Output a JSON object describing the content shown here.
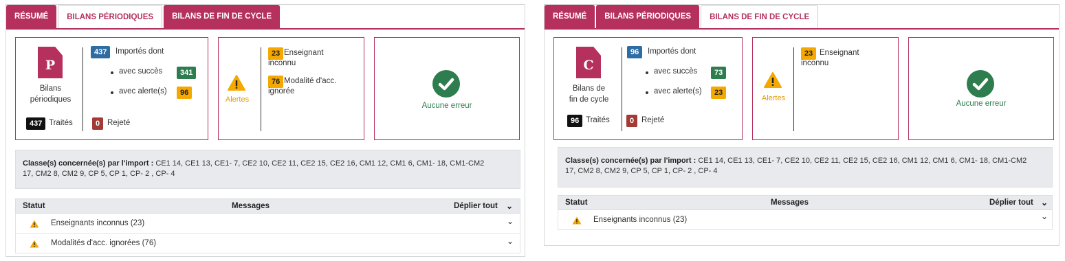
{
  "tabs": {
    "resume": "RÉSUMÉ",
    "periodiques": "BILANS PÉRIODIQUES",
    "fin_cycle": "BILANS DE FIN DE CYCLE"
  },
  "colors": {
    "primary": "#b5305c",
    "success": "#2e7d4f",
    "warning": "#f5a800",
    "info": "#2e6da4",
    "danger": "#a23b36"
  },
  "left": {
    "active_tab": "BILANS PÉRIODIQUES",
    "doc_letter": "P",
    "doc_label_1": "Bilans",
    "doc_label_2": "périodiques",
    "imported_count": "437",
    "imported_label": "Importés dont",
    "success_label": "avec succès",
    "success_count": "341",
    "alert_label": "avec alerte(s)",
    "alert_count": "96",
    "treated_count": "437",
    "treated_label": "Traités",
    "rejected_count": "0",
    "rejected_label": "Rejeté",
    "alerts_title": "Alertes",
    "alert1_count": "23",
    "alert1_line1": "Enseignant",
    "alert1_line2": "inconnu",
    "alert2_count": "76",
    "alert2_line1": "Modalité d'acc.",
    "alert2_line2": "ignorée",
    "no_error": "Aucune erreur",
    "classes_label": "Classe(s) concernée(s) par l'import :",
    "classes_line1": " CE1 14, CE1 13, CE1- 7, CE2 10, CE2 11, CE2 15, CE2 16, CM1 12, CM1 6, CM1- 18, CM1-CM2",
    "classes_line2": "17, CM2 8, CM2 9, CP 5, CP 1, CP- 2 , CP- 4",
    "col_status": "Statut",
    "col_messages": "Messages",
    "expand_all": "Déplier tout",
    "rows": [
      "Enseignants inconnus (23)",
      "Modalités d'acc. ignorées (76)"
    ]
  },
  "right": {
    "active_tab": "BILANS DE FIN DE CYCLE",
    "doc_letter": "C",
    "doc_label_1": "Bilans de",
    "doc_label_2": "fin de cycle",
    "imported_count": "96",
    "imported_label": "Importés dont",
    "success_label": "avec succès",
    "success_count": "73",
    "alert_label": "avec alerte(s)",
    "alert_count": "23",
    "treated_count": "96",
    "treated_label": "Traités",
    "rejected_count": "0",
    "rejected_label": "Rejeté",
    "alerts_title": "Alertes",
    "alert1_count": "23",
    "alert1_line1": "Enseignant",
    "alert1_line2": "inconnu",
    "no_error": "Aucune erreur",
    "classes_label": "Classe(s) concernée(s) par l'import :",
    "classes_line1": " CE1 14, CE1 13, CE1- 7, CE2 10, CE2 11, CE2 15, CE2 16, CM1 12, CM1 6, CM1- 18, CM1-CM2",
    "classes_line2": "17, CM2 8, CM2 9, CP 5, CP 1, CP- 2 , CP- 4",
    "col_status": "Statut",
    "col_messages": "Messages",
    "expand_all": "Déplier tout",
    "rows": [
      "Enseignants inconnus (23)"
    ]
  }
}
